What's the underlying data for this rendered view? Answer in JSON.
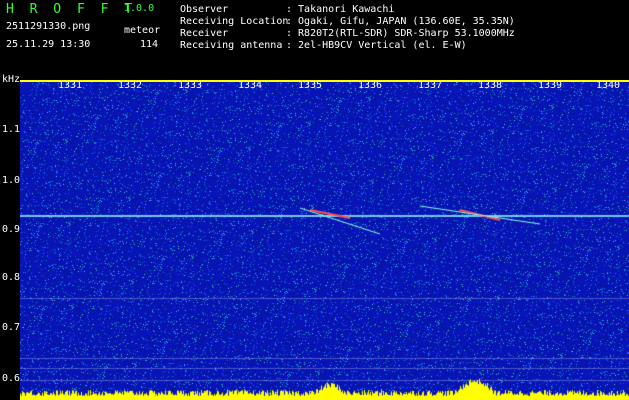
{
  "header": {
    "app_name": "H R O F F T",
    "version": "1.0.0",
    "filename": "2511291330.png",
    "meteor_label": "meteor",
    "datetime": "25.11.29 13:30",
    "meteor_count": "114"
  },
  "info": [
    {
      "key": "Observer",
      "value": ": Takanori Kawachi"
    },
    {
      "key": "Receiving Location",
      "value": ": Ogaki, Gifu, JAPAN (136.60E, 35.35N)"
    },
    {
      "key": "Receiver",
      "value": ": R820T2(RTL-SDR) SDR-Sharp 53.1000MHz"
    },
    {
      "key": "Receiving antenna",
      "value": ": 2el-HB9CV Vertical (el. E-W)"
    }
  ],
  "axis": {
    "unit": "kHz",
    "time_ticks": [
      "1331",
      "1332",
      "1333",
      "1334",
      "1335",
      "1336",
      "1337",
      "1338",
      "1339",
      "1340"
    ],
    "freq_ticks": [
      "1.1",
      "1.0",
      "0.9",
      "0.8",
      "0.7",
      "0.6"
    ]
  },
  "colors": {
    "background": "#000000",
    "label_green": "#33ff33",
    "label_white": "#ffffff",
    "accent_yellow": "#ffff00",
    "spectrum_blue": "#0a1ea8"
  }
}
